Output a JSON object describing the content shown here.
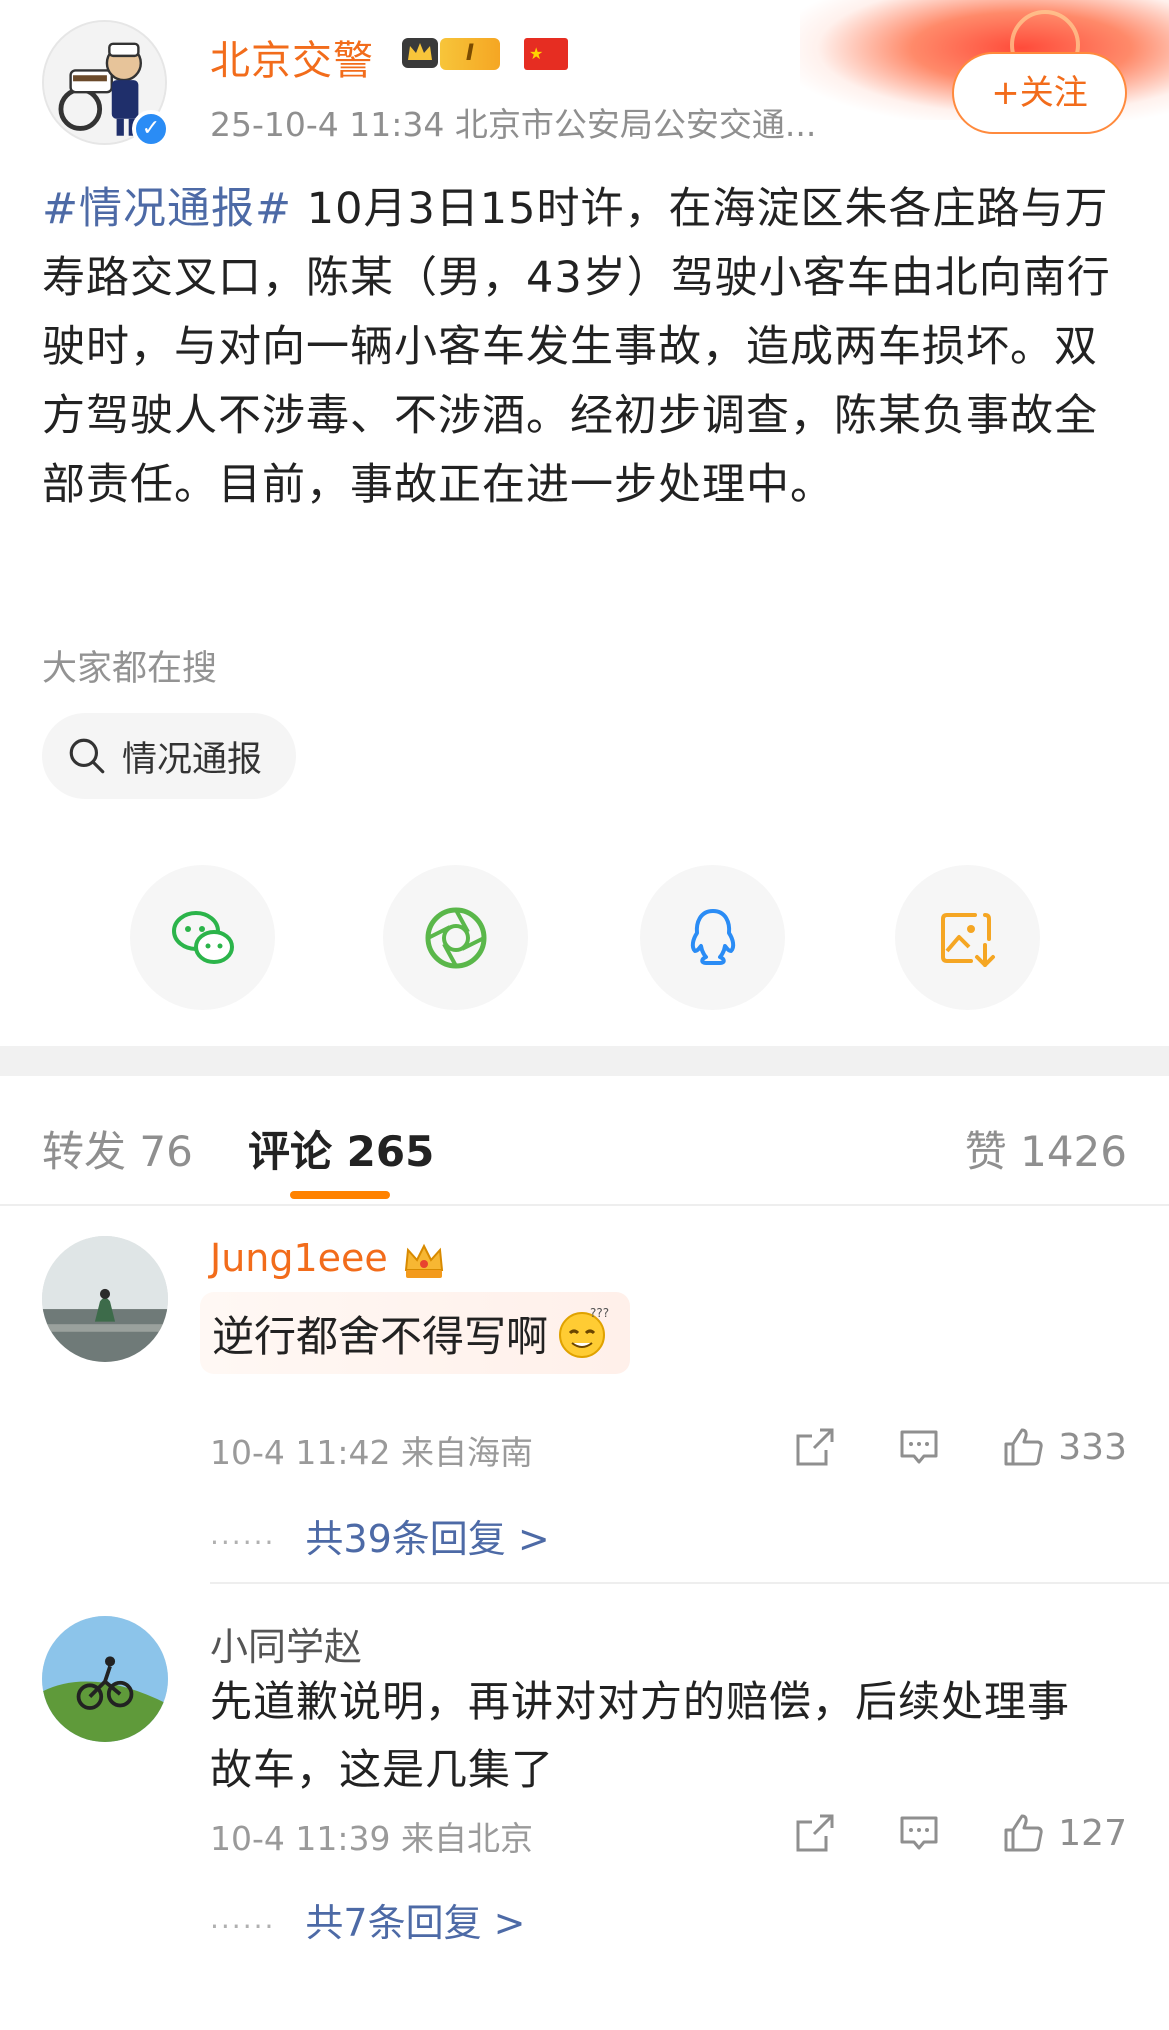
{
  "post": {
    "author": {
      "name": "北京交警",
      "level_badge": "I",
      "meta": "25-10-4 11:34  北京市公安局公安交通..."
    },
    "follow_label": "+关注",
    "hashtag": "#情况通报#",
    "body": " 10月3日15时许，在海淀区朱各庄路与万寿路交叉口，陈某（男，43岁）驾驶小客车由北向南行驶时，与对向一辆小客车发生事故，造成两车损坏。双方驾驶人不涉毒、不涉酒。经初步调查，陈某负事故全部责任。目前，事故正在进一步处理中。",
    "hot_search_label": "大家都在搜",
    "hot_search_chip": "情况通报"
  },
  "share": {
    "icons": [
      "wechat-icon",
      "moments-icon",
      "qq-icon",
      "save-image-icon"
    ],
    "colors": {
      "wechat": "#2bb44a",
      "moments": "#5ab74a",
      "qq": "#2a8cf5",
      "save": "#f5a623"
    }
  },
  "tabs": {
    "repost": "转发 76",
    "comments": "评论 265",
    "likes": "赞 1426"
  },
  "comments": [
    {
      "name": "Jung1eee",
      "text": "逆行都舍不得写啊",
      "meta": "10-4 11:42 来自海南",
      "likes": "333",
      "replies": "共39条回复 >"
    },
    {
      "name": "小同学赵",
      "text": "先道歉说明，再讲对对方的赔偿，后续处理事故车，这是几集了",
      "meta": "10-4 11:39 来自北京",
      "likes": "127",
      "replies": "共7条回复 >"
    }
  ],
  "colors": {
    "accent": "#ff8200",
    "username": "#f26c1b",
    "link": "#4d6aa6"
  }
}
